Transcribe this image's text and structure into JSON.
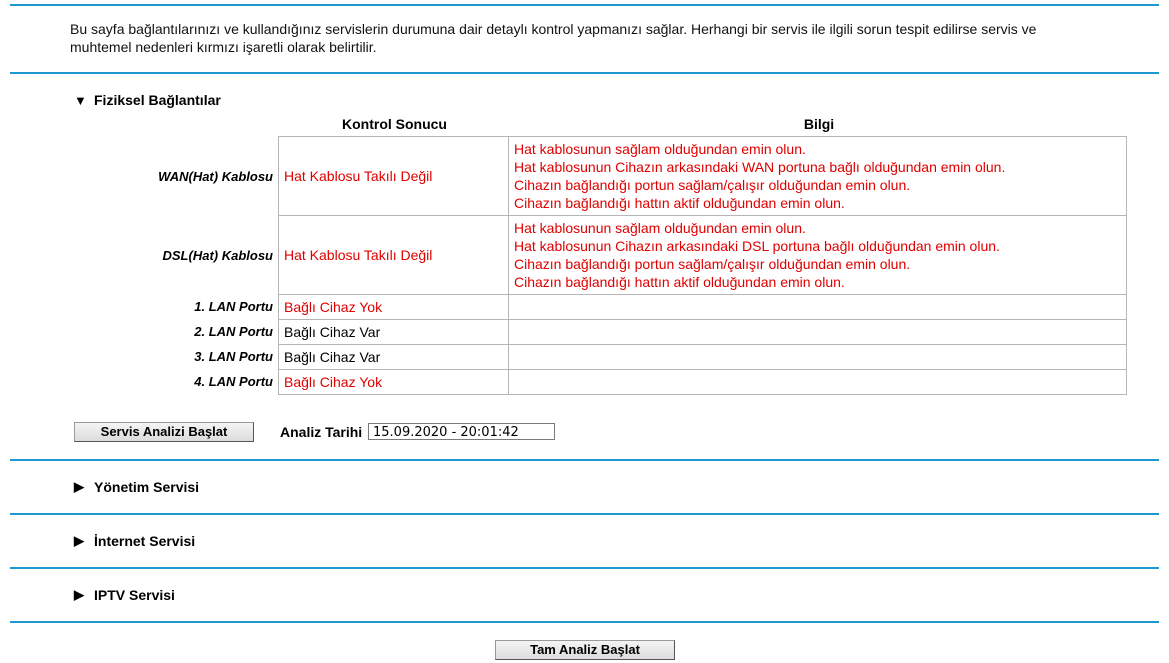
{
  "intro_text": "Bu sayfa bağlantılarınızı ve kullandığınız servislerin durumuna dair detaylı kontrol yapmanızı sağlar. Herhangi bir servis ile ilgili sorun tespit edilirse servis ve muhtemel nedenleri kırmızı işaretli olarak belirtilir.",
  "physical": {
    "title": "Fiziksel Bağlantılar",
    "expanded_icon": "▼",
    "col_result": "Kontrol Sonucu",
    "col_info": "Bilgi",
    "rows": [
      {
        "label": "WAN(Hat) Kablosu",
        "result": "Hat Kablosu Takılı Değil",
        "info": [
          "Hat kablosunun sağlam olduğundan emin olun.",
          "Hat kablosunun Cihazın arkasındaki WAN portuna bağlı olduğundan emin olun.",
          "Cihazın bağlandığı portun sağlam/çalışır olduğundan emin olun.",
          "Cihazın bağlandığı hattın aktif olduğundan emin olun."
        ]
      },
      {
        "label": "DSL(Hat) Kablosu",
        "result": "Hat Kablosu Takılı Değil",
        "info": [
          "Hat kablosunun sağlam olduğundan emin olun.",
          "Hat kablosunun Cihazın arkasındaki DSL portuna bağlı olduğundan emin olun.",
          "Cihazın bağlandığı portun sağlam/çalışır olduğundan emin olun.",
          "Cihazın bağlandığı hattın aktif olduğundan emin olun."
        ]
      },
      {
        "label": "1. LAN Portu",
        "result": "Bağlı Cihaz Yok"
      },
      {
        "label": "2. LAN Portu",
        "result": "Bağlı Cihaz Var"
      },
      {
        "label": "3. LAN Portu",
        "result": "Bağlı Cihaz Var"
      },
      {
        "label": "4. LAN Portu",
        "result": "Bağlı Cihaz Yok"
      }
    ],
    "start_button": "Servis Analizi Başlat",
    "date_label": "Analiz Tarihi",
    "date_value": "15.09.2020 - 20:01:42"
  },
  "sections": [
    {
      "title": "Yönetim Servisi",
      "icon": "▶"
    },
    {
      "title": "İnternet Servisi",
      "icon": "▶"
    },
    {
      "title": "IPTV Servisi",
      "icon": "▶"
    }
  ],
  "full_button": "Tam Analiz Başlat",
  "colors": {
    "accent": "#1a9ad1",
    "error": "#e00000"
  }
}
